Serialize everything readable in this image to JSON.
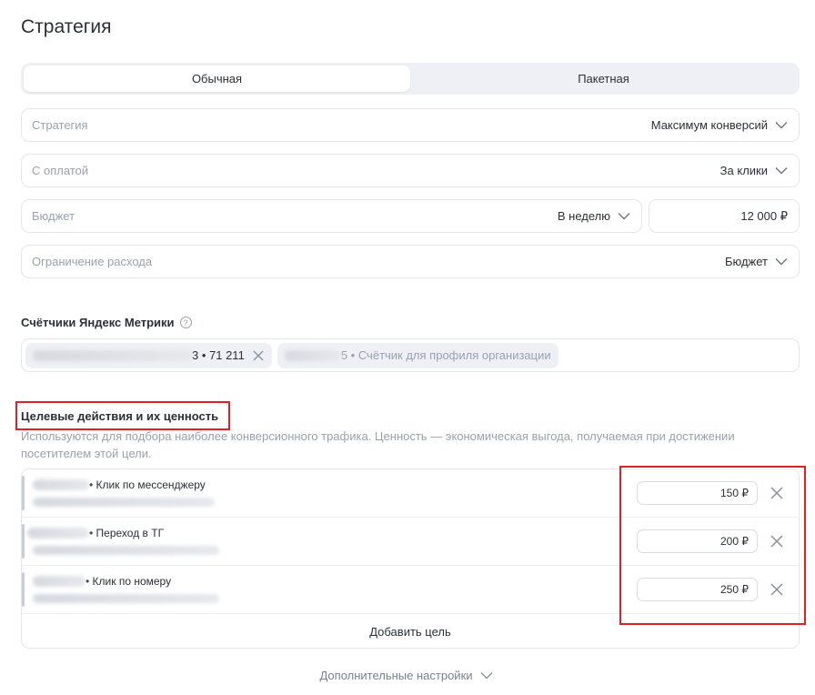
{
  "page": {
    "title": "Стратегия"
  },
  "tabs": [
    {
      "label": "Обычная",
      "active": true
    },
    {
      "label": "Пакетная",
      "active": false
    }
  ],
  "fields": {
    "strategy": {
      "label": "Стратегия",
      "value": "Максимум конверсий"
    },
    "payment": {
      "label": "С оплатой",
      "value": "За клики"
    },
    "budget": {
      "label": "Бюджет",
      "period": "В неделю",
      "amount": "12 000 ₽"
    },
    "limit": {
      "label": "Ограничение расхода",
      "value": "Бюджет"
    }
  },
  "metrics": {
    "title": "Счётчики Яндекс Метрики",
    "help_icon": "?",
    "chips": [
      {
        "text": "3 • 71   211"
      },
      {
        "text": "5 • Счётчик для профиля организации"
      }
    ]
  },
  "goals": {
    "title": "Целевые действия и их ценность",
    "description": "Используются для подбора наиболее конверсионного трафика. Ценность — экономическая выгода, получаемая при достижении посетителем этой цели.",
    "items": [
      {
        "name": "• Клик по мессенджеру",
        "value": "150 ₽"
      },
      {
        "name": "• Переход в ТГ",
        "value": "200 ₽"
      },
      {
        "name": "• Клик по номеру",
        "value": "250 ₽"
      }
    ],
    "add_label": "Добавить цель"
  },
  "advanced": {
    "label": "Дополнительные настройки"
  },
  "colors": {
    "highlight": "#e11f26",
    "border": "#e3e6ec",
    "muted": "#9aa1ad"
  }
}
